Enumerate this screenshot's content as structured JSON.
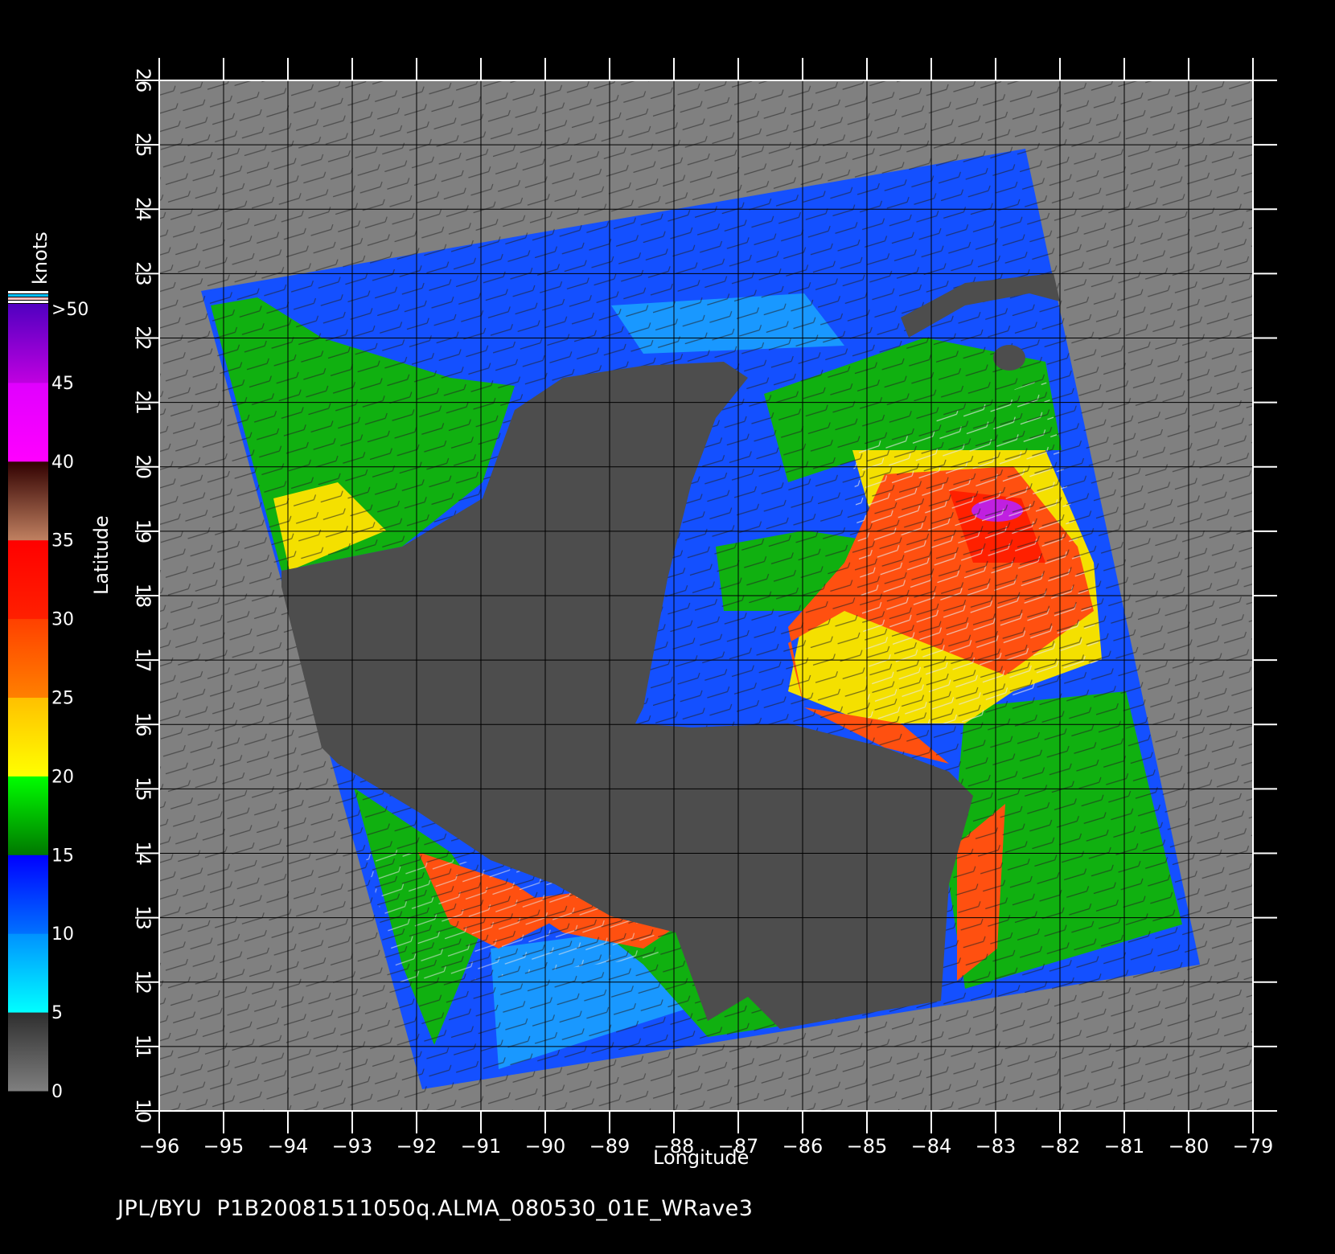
{
  "map": {
    "x_axis_title": "Longitude",
    "y_axis_title": "Latitude",
    "lon_ticks": [
      "−96",
      "−95",
      "−94",
      "−93",
      "−92",
      "−91",
      "−90",
      "−89",
      "−88",
      "−87",
      "−86",
      "−85",
      "−84",
      "−83",
      "−82",
      "−81",
      "−80",
      "−79"
    ],
    "lat_ticks": [
      "10",
      "11",
      "12",
      "13",
      "14",
      "15",
      "16",
      "17",
      "18",
      "19",
      "20",
      "21",
      "22",
      "23",
      "24",
      "25",
      "26"
    ],
    "lon_range": [
      -96,
      -79
    ],
    "lat_range": [
      10,
      26
    ],
    "land_color": "#4d4d4d",
    "nodata_color": "#808080",
    "background_color": "#000000"
  },
  "colorbar": {
    "title": "knots",
    "labels": [
      "0",
      "5",
      "10",
      "15",
      "20",
      "25",
      "30",
      "35",
      "40",
      "45",
      ">50"
    ],
    "colors": {
      "0-5": [
        "#7f7f7f",
        "#2e2e2e"
      ],
      "5-10": [
        "#00ffff",
        "#0091ff"
      ],
      "10-15": [
        "#0071ff",
        "#0000ff"
      ],
      "15-20": [
        "#007800",
        "#00ff00"
      ],
      "20-25": [
        "#ffff00",
        "#ffc000"
      ],
      "25-30": [
        "#ff8000",
        "#ff4000"
      ],
      "30-35": [
        "#ff2000",
        "#ff0000"
      ],
      "35-40": [
        "#c08060",
        "#300000"
      ],
      "40-45": [
        "#ff00ff",
        "#e000ff"
      ],
      "45-50": [
        "#c000e0",
        "#5000c0"
      ]
    }
  },
  "footer": {
    "text": "JPL/BYU  P1B20081511050q.ALMA_080530_01E_WRave3"
  }
}
